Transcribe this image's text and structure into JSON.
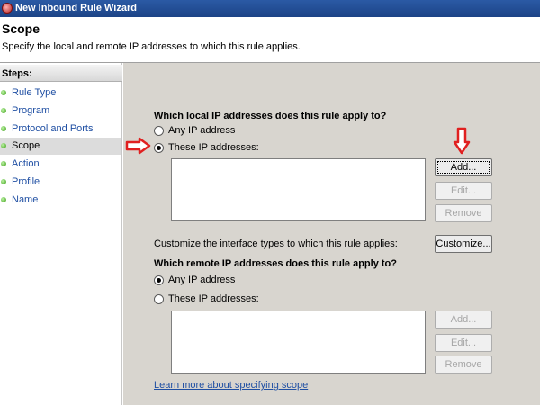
{
  "window": {
    "title": "New Inbound Rule Wizard",
    "icon": "firewall-icon"
  },
  "header": {
    "title": "Scope",
    "subtitle": "Specify the local and remote IP addresses to which this rule applies."
  },
  "sidebar": {
    "header": "Steps:",
    "items": [
      {
        "label": "Rule Type"
      },
      {
        "label": "Program"
      },
      {
        "label": "Protocol and Ports"
      },
      {
        "label": "Scope"
      },
      {
        "label": "Action"
      },
      {
        "label": "Profile"
      },
      {
        "label": "Name"
      }
    ],
    "active_index": 3
  },
  "local": {
    "question": "Which local IP addresses does this rule apply to?",
    "any_label": "Any IP address",
    "these_label": "These IP addresses:",
    "selected": "these",
    "add_label": "Add...",
    "edit_label": "Edit...",
    "remove_label": "Remove"
  },
  "interface": {
    "text": "Customize the interface types to which this rule applies:",
    "button_label": "Customize..."
  },
  "remote": {
    "question": "Which remote IP addresses does this rule apply to?",
    "any_label": "Any IP address",
    "these_label": "These IP addresses:",
    "selected": "any",
    "add_label": "Add...",
    "edit_label": "Edit...",
    "remove_label": "Remove"
  },
  "learn_more": "Learn more about specifying scope",
  "colors": {
    "annotation_arrow": "#e02020",
    "link": "#1f4fa3",
    "panel": "#d8d5cf"
  }
}
